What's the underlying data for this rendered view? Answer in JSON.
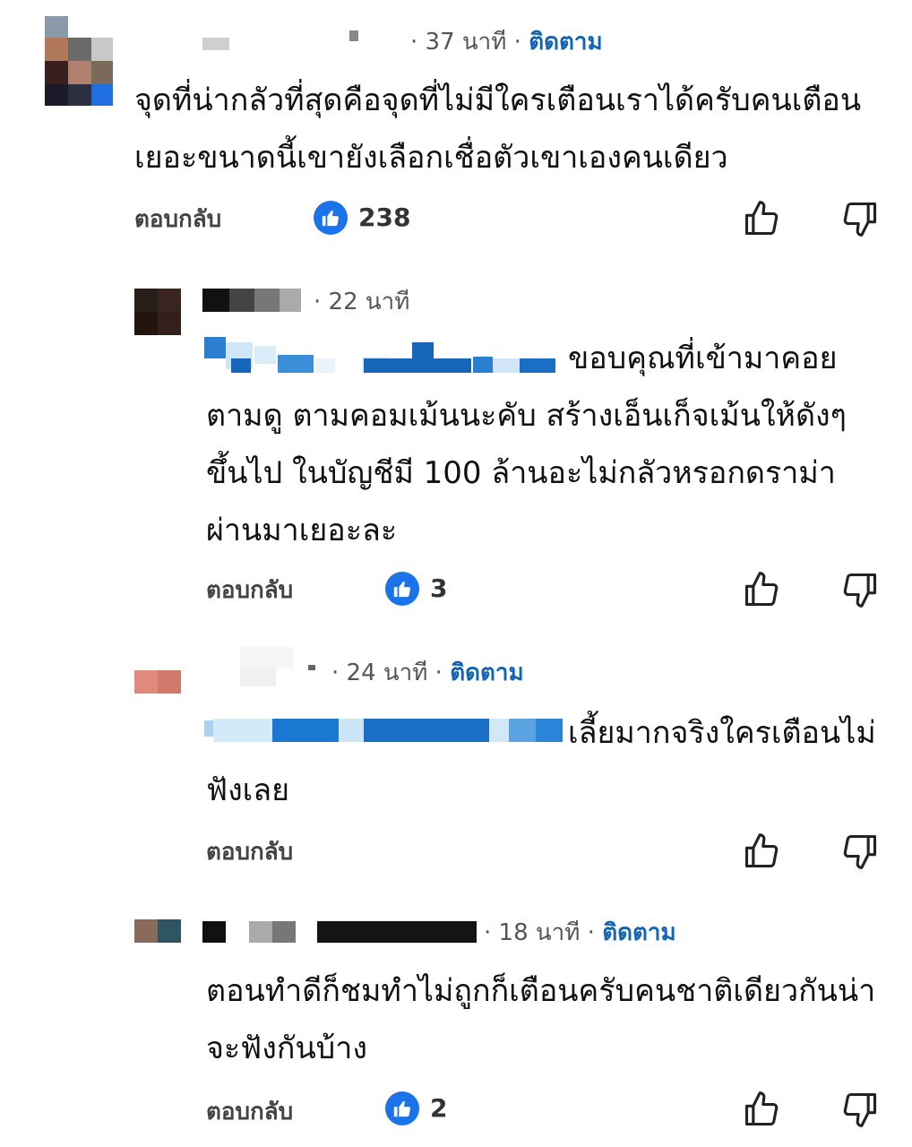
{
  "comments": [
    {
      "time": "· 37 นาที ·",
      "follow": "ติดตาม",
      "text": "จุดที่น่ากลัวที่สุดคือจุดที่ไม่มีใครเตือนเราได้ครับคนเตือนเยอะขนาดนี้เขายังเลือกเชื่อตัวเขาเองคนเดียว",
      "reply": "ตอบกลับ",
      "likes": "238"
    },
    {
      "time": "· 22 นาที",
      "text": "ขอบคุณที่เข้ามาคอยตามดู ตามคอมเม้นนะคับ สร้างเอ็นเก็จเม้นให้ดังๆขึ้นไป ในบัญชีมี 100 ล้านอะไม่กลัวหรอกดราม่าผ่านมาเยอะละ",
      "reply": "ตอบกลับ",
      "likes": "3"
    },
    {
      "time": "· 24 นาที ·",
      "follow": "ติดตาม",
      "text": "เลี้ยมากจริงใครเตือนไม่ฟังเลย",
      "reply": "ตอบกลับ"
    },
    {
      "time": "· 18 นาที ·",
      "follow": "ติดตาม",
      "text": "ตอนทำดีก็ชมทำไม่ถูกก็เตือนครับคนชาติเดียวกันน่าจะฟังกันบ้าง",
      "reply": "ตอบกลับ",
      "likes": "2"
    }
  ],
  "icons": {
    "like": "thumbs-up-icon",
    "dislike": "thumbs-down-icon",
    "like_badge": "like-badge-icon"
  },
  "colors": {
    "accent": "#1a73e8",
    "follow": "#1464b4",
    "meta": "#555555"
  }
}
